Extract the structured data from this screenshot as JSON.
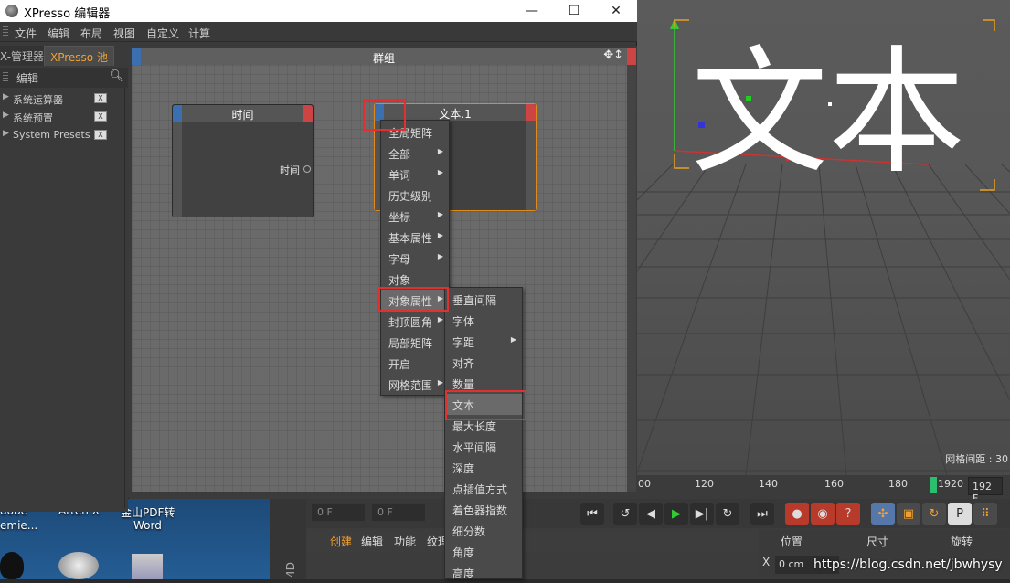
{
  "window": {
    "title": "XPresso 编辑器",
    "minimize": "—",
    "maximize": "☐",
    "close": "✕"
  },
  "menubar": [
    "文件",
    "编辑",
    "布局",
    "视图",
    "自定义",
    "计算"
  ],
  "left_panel": {
    "tabs": [
      "X-管理器",
      "XPresso 池"
    ],
    "active_tab": "XPresso 池",
    "sub_label": "编辑",
    "tree": [
      "系统运算器",
      "系统预置",
      "System Presets"
    ]
  },
  "canvas": {
    "group_title": "群组",
    "nodes": [
      {
        "title": "时间",
        "port": "时间"
      },
      {
        "title": "文本.1"
      }
    ]
  },
  "context_menu": {
    "items": [
      {
        "label": "全局矩阵",
        "submenu": false
      },
      {
        "label": "全部",
        "submenu": true
      },
      {
        "label": "单词",
        "submenu": true
      },
      {
        "label": "历史级别",
        "submenu": false
      },
      {
        "label": "坐标",
        "submenu": true
      },
      {
        "label": "基本属性",
        "submenu": true
      },
      {
        "label": "字母",
        "submenu": true
      },
      {
        "label": "对象",
        "submenu": false
      },
      {
        "label": "对象属性",
        "submenu": true,
        "highlighted": true
      },
      {
        "label": "封顶圆角",
        "submenu": true
      },
      {
        "label": "局部矩阵",
        "submenu": false
      },
      {
        "label": "开启",
        "submenu": false
      },
      {
        "label": "网格范围",
        "submenu": true
      }
    ]
  },
  "submenu": {
    "items": [
      {
        "label": "垂直间隔",
        "submenu": false
      },
      {
        "label": "字体",
        "submenu": false
      },
      {
        "label": "字距",
        "submenu": true
      },
      {
        "label": "对齐",
        "submenu": false
      },
      {
        "label": "数量",
        "submenu": false
      },
      {
        "label": "文本",
        "submenu": false,
        "highlighted": true
      },
      {
        "label": "最大长度",
        "submenu": false
      },
      {
        "label": "水平间隔",
        "submenu": false
      },
      {
        "label": "深度",
        "submenu": false
      },
      {
        "label": "点插值方式",
        "submenu": false
      },
      {
        "label": "着色器指数",
        "submenu": false
      },
      {
        "label": "细分数",
        "submenu": false
      },
      {
        "label": "角度",
        "submenu": false
      },
      {
        "label": "高度",
        "submenu": false
      }
    ]
  },
  "viewport": {
    "text_3d": "文本",
    "grid_distance": "网格间距 : 30"
  },
  "timeline": {
    "ticks": [
      "00",
      "120",
      "140",
      "160",
      "180",
      "1920"
    ],
    "current": "192 F"
  },
  "transport": {
    "frame_start": "0 F",
    "frame_current": "0 F"
  },
  "bottom_menu": [
    "创建",
    "编辑",
    "功能",
    "纹理"
  ],
  "attributes": {
    "headers": [
      "位置",
      "尺寸",
      "旋转"
    ],
    "x_label": "X",
    "x_value": "0 cm"
  },
  "desktop": {
    "labels": [
      "dobe",
      "emie...",
      "Arten X",
      "金山PDF转",
      "Word"
    ]
  },
  "watermark": "https://blog.csdn.net/jbwhysy",
  "colors": {
    "accent": "#f0a030",
    "node_port_in": "#3b6fb0",
    "node_port_out": "#cc4444",
    "annotation": "#e03030"
  }
}
